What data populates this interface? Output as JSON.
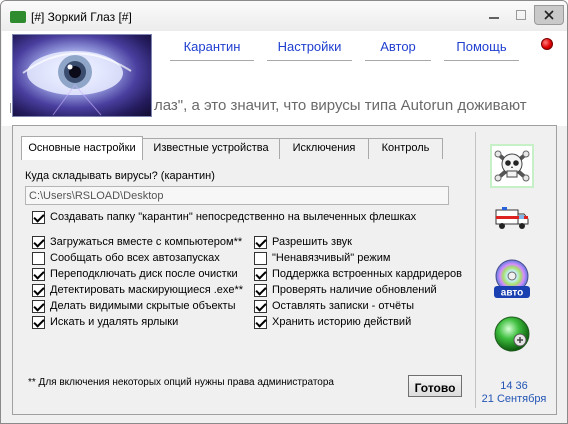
{
  "window": {
    "title": "[#] Зоркий Глаз [#]",
    "app_icon_text": "Antivir"
  },
  "nav": {
    "karantin": "Карантин",
    "settings": "Настройки",
    "author": "Автор",
    "help": "Помощь"
  },
  "marquee": "лаз\", а это значит, что вирусы типа Autorun доживают",
  "tabs": [
    {
      "label": "Основные настройки",
      "active": true
    },
    {
      "label": "Известные устройства",
      "active": false
    },
    {
      "label": "Исключения",
      "active": false
    },
    {
      "label": "Контроль",
      "active": false
    }
  ],
  "quarantine": {
    "label": "Куда складывать вирусы? (карантин)",
    "path": "C:\\Users\\RSLOAD\\Desktop"
  },
  "options": {
    "create_folder": {
      "label": "Создавать папку \"карантин\" непосредственно на вылеченных флешках",
      "checked": true
    },
    "left": [
      {
        "label": "Загружаться вместе с компьютером**",
        "checked": true
      },
      {
        "label": "Сообщать обо всех автозапусках",
        "checked": false
      },
      {
        "label": "Переподключать диск после очистки",
        "checked": true
      },
      {
        "label": "Детектировать маскирующиеся .exe**",
        "checked": true
      },
      {
        "label": "Делать видимыми скрытые объекты",
        "checked": true
      },
      {
        "label": "Искать и удалять ярлыки",
        "checked": true
      }
    ],
    "right": [
      {
        "label": "Разрешить звук",
        "checked": true
      },
      {
        "label": "\"Ненавязчивый\" режим",
        "checked": false
      },
      {
        "label": "Поддержка встроенных кардридеров",
        "checked": true
      },
      {
        "label": "Проверять наличие обновлений",
        "checked": true
      },
      {
        "label": "Оставлять записки - отчёты",
        "checked": true
      },
      {
        "label": "Хранить историю действий",
        "checked": true
      }
    ]
  },
  "footer": {
    "note": "** Для включения некоторых опций нужны права администратора",
    "ok_label": "Готово"
  },
  "side": {
    "cd_label": "авто"
  },
  "clock": {
    "time": "14 36",
    "date": "21 Сентября"
  },
  "colors": {
    "link": "#1f3fd0",
    "clock": "#2355b5",
    "status_dot": "#e00000"
  }
}
